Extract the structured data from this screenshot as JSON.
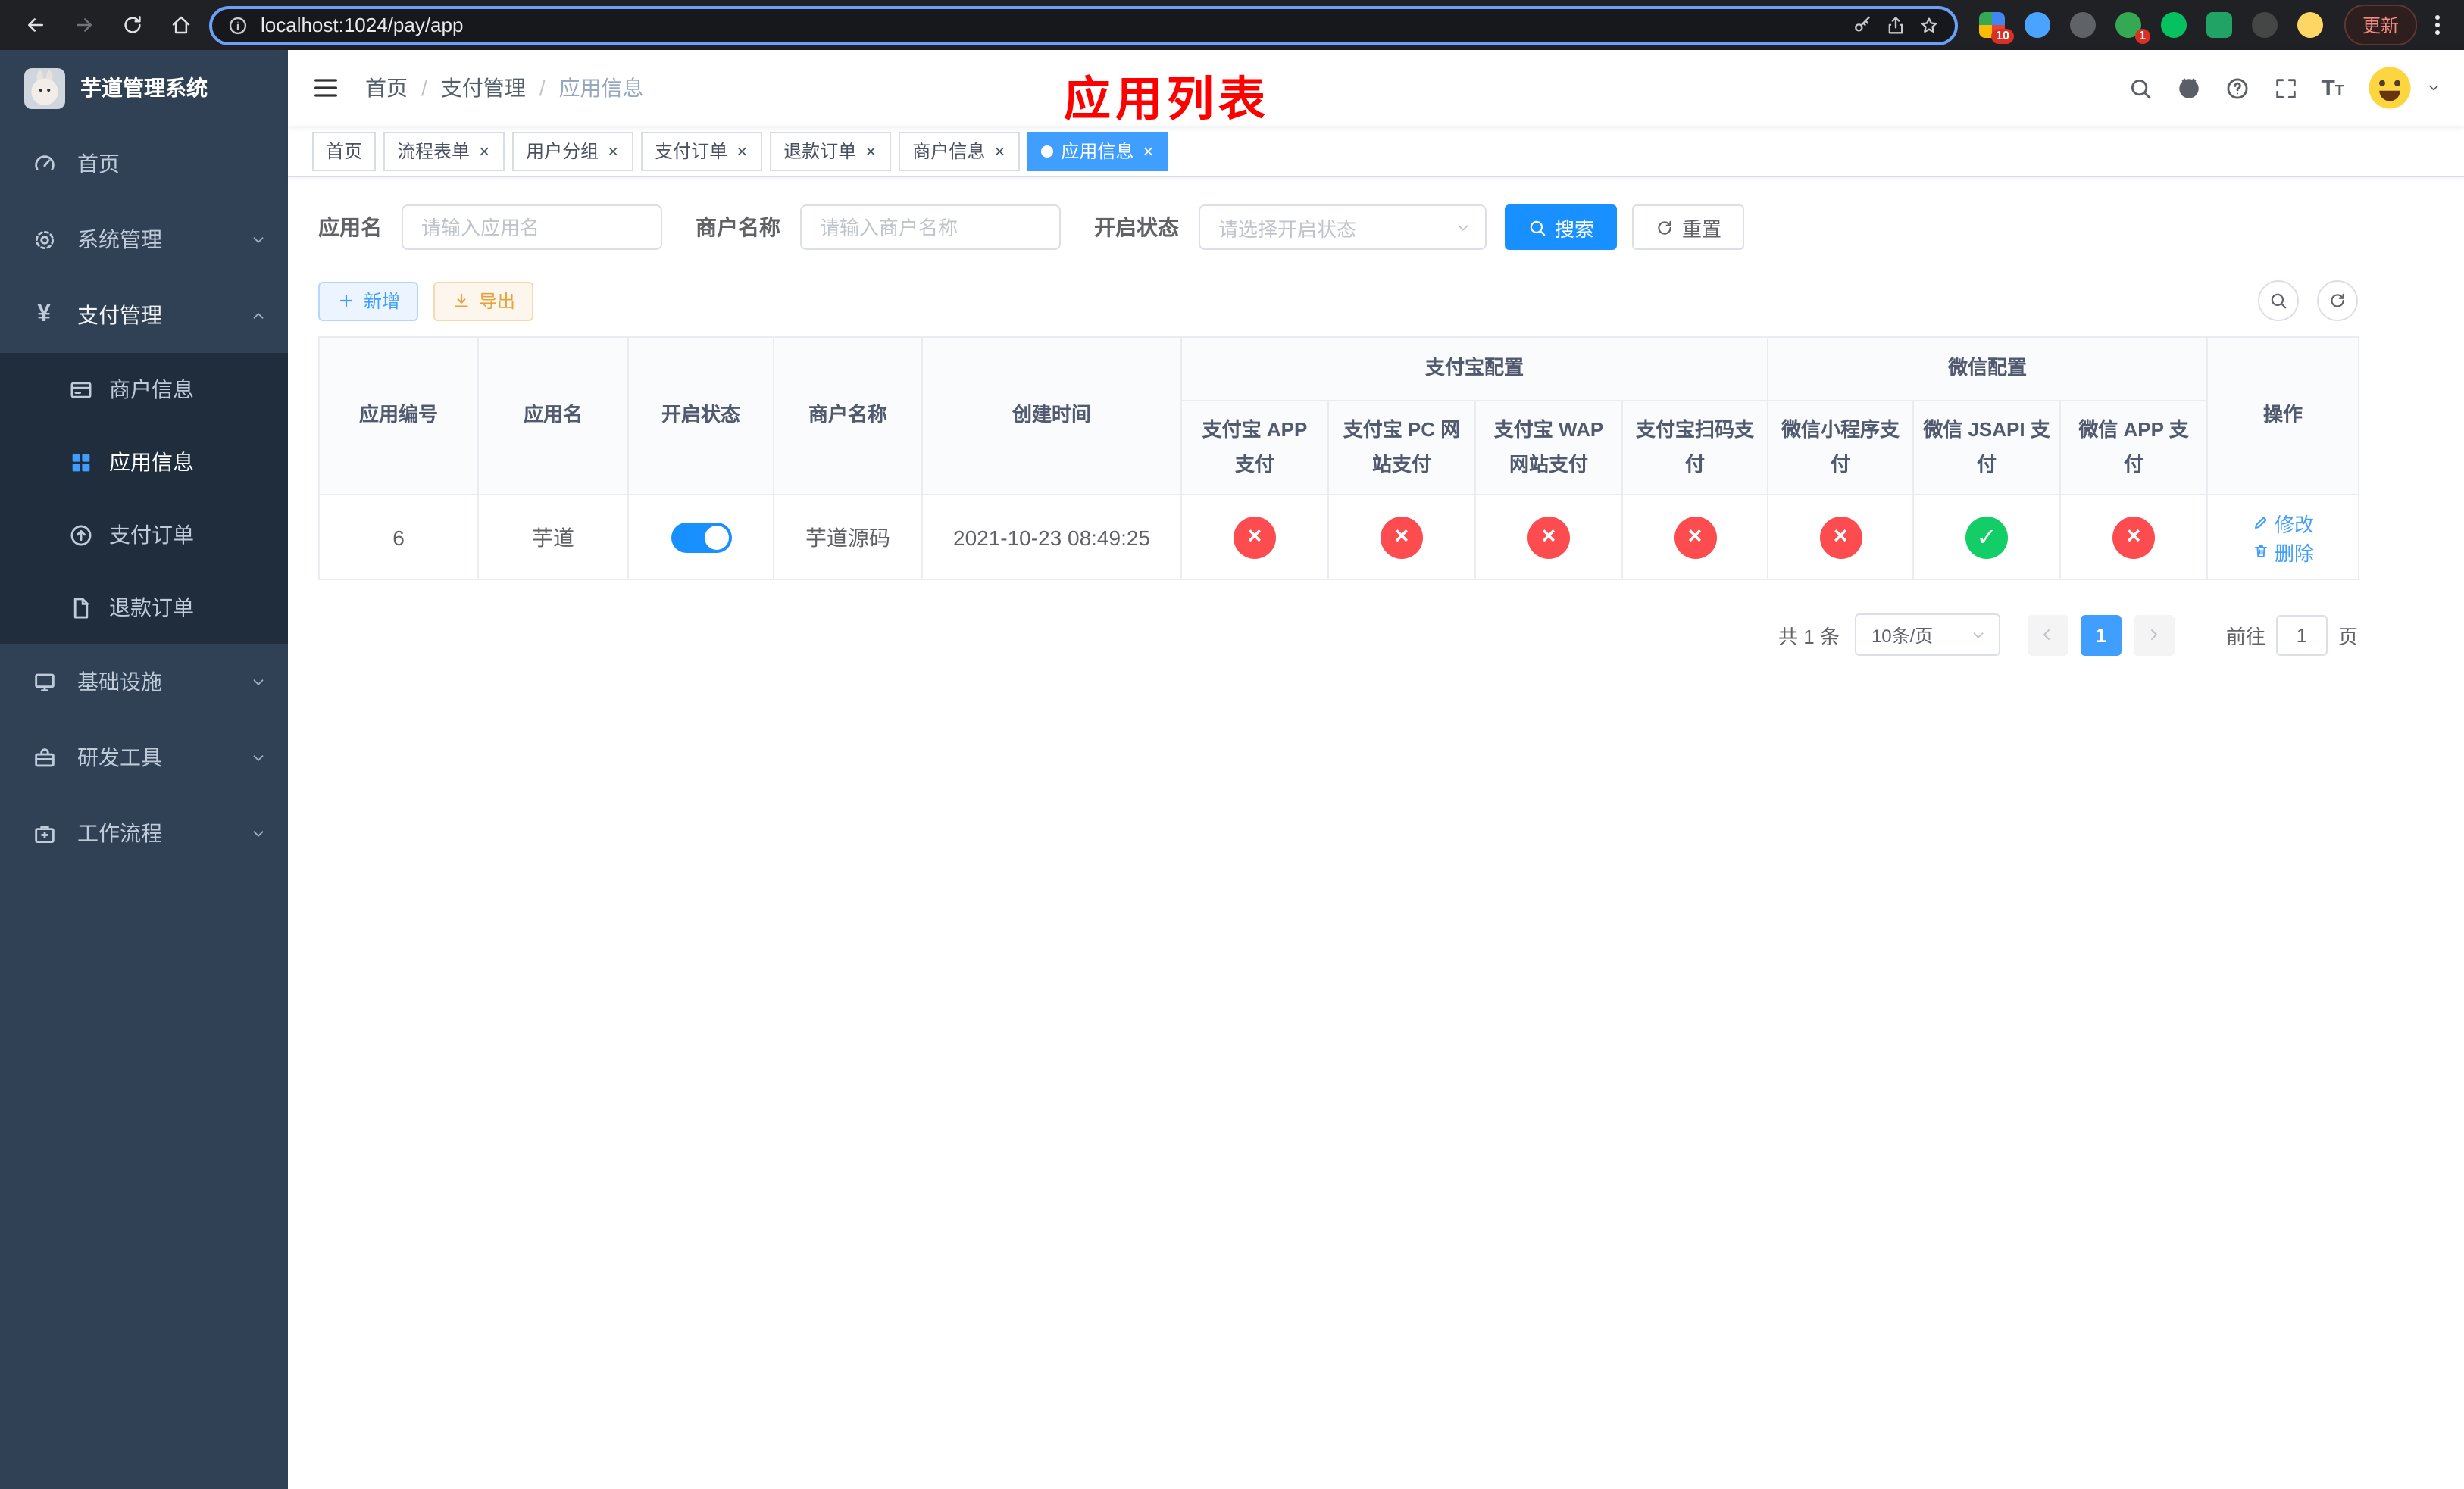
{
  "colors": {
    "primary": "#409eff",
    "button_blue": "#1890ff",
    "danger_red": "#fd4c4f",
    "success_green": "#13ce66",
    "warning_orange": "#e6a23c",
    "annotation_red": "#ff0000",
    "sidebar_bg": "#304156",
    "sidebar_sub_bg": "#1f2d3d"
  },
  "browser": {
    "url": "localhost:1024/pay/app",
    "update_label": "更新",
    "ext_badge_puzzle": "10",
    "ext_badge_green": "1"
  },
  "sidebar": {
    "app_title": "芋道管理系统",
    "items": [
      {
        "label": "首页"
      },
      {
        "label": "系统管理"
      },
      {
        "label": "支付管理",
        "children": [
          {
            "label": "商户信息"
          },
          {
            "label": "应用信息"
          },
          {
            "label": "支付订单"
          },
          {
            "label": "退款订单"
          }
        ]
      },
      {
        "label": "基础设施"
      },
      {
        "label": "研发工具"
      },
      {
        "label": "工作流程"
      }
    ]
  },
  "header": {
    "breadcrumb": [
      "首页",
      "支付管理",
      "应用信息"
    ],
    "annotation": "应用列表"
  },
  "tabs": [
    {
      "label": "首页"
    },
    {
      "label": "流程表单"
    },
    {
      "label": "用户分组"
    },
    {
      "label": "支付订单"
    },
    {
      "label": "退款订单"
    },
    {
      "label": "商户信息"
    },
    {
      "label": "应用信息"
    }
  ],
  "filters": {
    "app_name_label": "应用名",
    "app_name_placeholder": "请输入应用名",
    "merchant_label": "商户名称",
    "merchant_placeholder": "请输入商户名称",
    "status_label": "开启状态",
    "status_placeholder": "请选择开启状态",
    "search_label": "搜索",
    "reset_label": "重置"
  },
  "toolbar": {
    "add_label": "新增",
    "export_label": "导出"
  },
  "table": {
    "group_alipay": "支付宝配置",
    "group_wechat": "微信配置",
    "col_app_id": "应用编号",
    "col_app_name": "应用名",
    "col_status": "开启状态",
    "col_merchant": "商户名称",
    "col_created": "创建时间",
    "col_alipay_app": "支付宝 APP 支付",
    "col_alipay_pc": "支付宝 PC 网站支付",
    "col_alipay_wap": "支付宝 WAP 网站支付",
    "col_alipay_qr": "支付宝扫码支付",
    "col_wx_mini": "微信小程序支付",
    "col_wx_jsapi": "微信 JSAPI 支付",
    "col_wx_app": "微信 APP 支付",
    "col_actions": "操作",
    "rows": [
      {
        "app_id": "6",
        "app_name": "芋道",
        "enabled": true,
        "merchant": "芋道源码",
        "created": "2021-10-23 08:49:25",
        "configs": {
          "alipay_app": "fail",
          "alipay_pc": "fail",
          "alipay_wap": "fail",
          "alipay_qr": "fail",
          "wx_mini": "fail",
          "wx_jsapi": "ok",
          "wx_app": "fail"
        },
        "edit_label": "修改",
        "delete_label": "删除"
      }
    ]
  },
  "pagination": {
    "total": "共 1 条",
    "page_size": "10条/页",
    "page": "1",
    "goto_label": "前往",
    "goto_value": "1",
    "goto_unit": "页"
  }
}
